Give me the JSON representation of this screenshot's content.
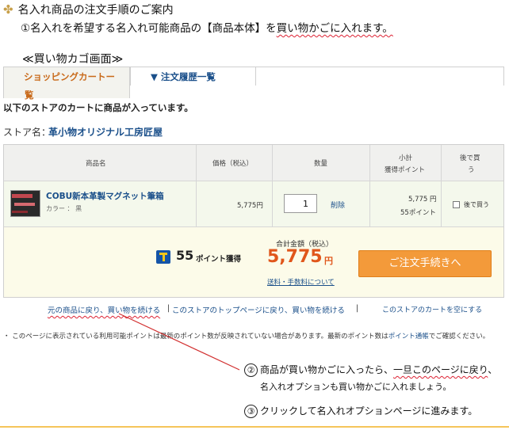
{
  "heading": {
    "title": "名入れ商品の注文手順のご案内",
    "step1_prefix": "①名入れを希望する名入れ可能商品の【商品本体】を",
    "step1_underlined": "買い物かごに入れます。",
    "cart_screen_label": "≪買い物カゴ画面≫"
  },
  "tabs": {
    "active_line1": "ショッピングカートー",
    "active_line2": "覧",
    "second": "▼ 注文履歴一覧"
  },
  "store": {
    "message": "以下のストアのカートに商品が入っています。",
    "name_label": "ストア名：",
    "name": "革小物オリジナル工房匠屋"
  },
  "table": {
    "headers": {
      "product": "商品名",
      "price": "価格（税込）",
      "quantity": "数量",
      "subtotal_line1": "小計",
      "subtotal_line2": "獲得ポイント",
      "later_line1": "後で買",
      "later_line2": "う"
    },
    "item": {
      "name": "COBU新本革製マグネット筆箱",
      "color": "カラー ： 黒",
      "price": "5,775円",
      "quantity": "1",
      "delete": "削除",
      "subtotal": "5,775 円",
      "points": "55ポイント",
      "buy_later": "後で買う"
    }
  },
  "totals": {
    "points_num": "55",
    "points_label": "ポイント獲得",
    "total_label": "合計金額（税込）",
    "total_amount": "5,775",
    "total_yen": "円",
    "shipping_link": "送料・手数料について",
    "checkout_button": "ご注文手続きへ"
  },
  "links": {
    "back_to_shopping": "元の商品に戻り、買い物を続ける",
    "sep1": "|",
    "store_top": "このストアのトップページに戻り、買い物を続ける",
    "sep2": "|",
    "empty_cart": "このストアのカートを空にする"
  },
  "note": {
    "part1": "・ このページに表示されている利用可能ポイントは最新のポイント数が反映されていない場合があります。最新のポイント数は",
    "link": "ポイント通帳",
    "part2": "でご確認ください。"
  },
  "instructions": {
    "step2_num": "②",
    "step2_prefix": "商品が買い物かごに入ったら、",
    "step2_underlined": "一旦このページに戻り",
    "step2_suffix": "、",
    "step2_line2": "名入れオプションも買い物かごに入れましょう。",
    "step3_num": "③",
    "step3_text": "クリックして名入れオプションページに進みます。"
  },
  "colors": {
    "link_blue": "#1a4f8a",
    "accent_orange": "#e0561b",
    "button_orange": "#f39a3a",
    "annotation_red": "#d23030"
  }
}
